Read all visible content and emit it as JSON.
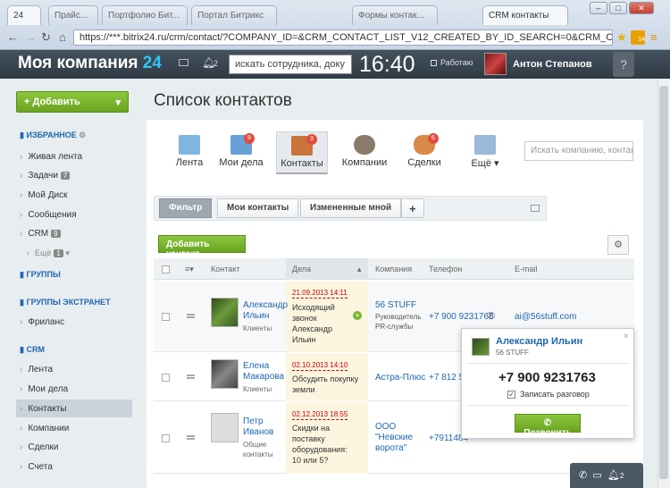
{
  "browser": {
    "tabs": [
      "24",
      "Прайс...",
      "Портфолио Бит...",
      "Портал Битрикс",
      "Формы контак...",
      "CRM контакты"
    ],
    "url": "https://***.bitrix24.ru/crm/contact/?COMPANY_ID=&CRM_CONTACT_LIST_V12_CREATED_BY_ID_SEARCH=0&CRM_CON",
    "ext_badge": "14"
  },
  "header": {
    "logo_text": "Моя компания ",
    "logo_num": "24",
    "notif_count": "2",
    "search_placeholder": "искать сотрудника, доку",
    "clock": "16:40",
    "status": "Работаю",
    "user_name": "Антон Степанов",
    "help": "?"
  },
  "sidebar": {
    "add_label": "Добавить",
    "favorites": "ИЗБРАННОЕ",
    "items": [
      {
        "label": "Живая лента",
        "count": ""
      },
      {
        "label": "Задачи",
        "count": "7"
      },
      {
        "label": "Мой Диск",
        "count": ""
      },
      {
        "label": "Сообщения",
        "count": ""
      },
      {
        "label": "CRM",
        "count": "9"
      },
      {
        "label": "Ещё",
        "count": "1"
      }
    ],
    "groups": "ГРУППЫ",
    "ext_groups": "ГРУППЫ ЭКСТРАНЕТ",
    "ext_items": [
      {
        "label": "Фриланс"
      }
    ],
    "crm": "CRM",
    "crm_items": [
      {
        "label": "Лента"
      },
      {
        "label": "Мои дела"
      },
      {
        "label": "Контакты"
      },
      {
        "label": "Компании"
      },
      {
        "label": "Сделки"
      },
      {
        "label": "Счета"
      }
    ]
  },
  "page": {
    "title": "Список контактов",
    "tabs": [
      {
        "label": "Лента",
        "badge": ""
      },
      {
        "label": "Мои дела",
        "badge": "9"
      },
      {
        "label": "Контакты",
        "badge": "3"
      },
      {
        "label": "Компании",
        "badge": ""
      },
      {
        "label": "Сделки",
        "badge": "6"
      },
      {
        "label": "Ещё",
        "badge": ""
      }
    ],
    "search_placeholder": "Искать компанию, контакт, сд",
    "filters": [
      "Фильтр",
      "Мои контакты",
      "Измененные мной",
      "+"
    ],
    "add_contact": "Добавить контакт",
    "columns": [
      "Контакт",
      "Дела",
      "Компания",
      "Телефон",
      "E-mail"
    ]
  },
  "rows": [
    {
      "name1": "Александр",
      "name2": "Ильин",
      "type": "Клиенты",
      "deal_date": "21.09.2013 14:11",
      "deal": [
        "Исходящий",
        "звонок",
        "Александр",
        "Ильин"
      ],
      "company": "56 STUFF",
      "company_sub": [
        "Руководитель",
        "PR-службы"
      ],
      "phone": "+7 900 9231763",
      "email": "ai@56stuff.com"
    },
    {
      "name1": "Елена",
      "name2": "Макарова",
      "type": "Клиенты",
      "deal_date": "02.10.2013 14:10",
      "deal": [
        "Обсудить покупку",
        "земли"
      ],
      "company": "Астра-Плюс",
      "company_sub": [],
      "phone": "+7 812 54",
      "email": ""
    },
    {
      "name1": "Петр",
      "name2": "Иванов",
      "type": "Общие",
      "type2": "контакты",
      "deal_date": "02.12.2013 18:55",
      "deal": [
        "Скидки на",
        "поставку",
        "оборудования:",
        "10 или 5?"
      ],
      "company": "ООО",
      "company_sub": [
        "\"Невские",
        "ворота\""
      ],
      "phone": "+7911484",
      "email": ""
    }
  ],
  "popup": {
    "name": "Александр Ильин",
    "company": "56 STUFF",
    "phone": "+7 900 9231763",
    "record_label": "Записать разговор",
    "call_label": "Позвонить",
    "close": "×"
  },
  "bottom_bar": {
    "count": "2"
  },
  "colors": {
    "accent_green": "#6aa420",
    "link_blue": "#2067b0",
    "header_dark": "#2f3a44",
    "badge_red": "#e14c3d"
  }
}
